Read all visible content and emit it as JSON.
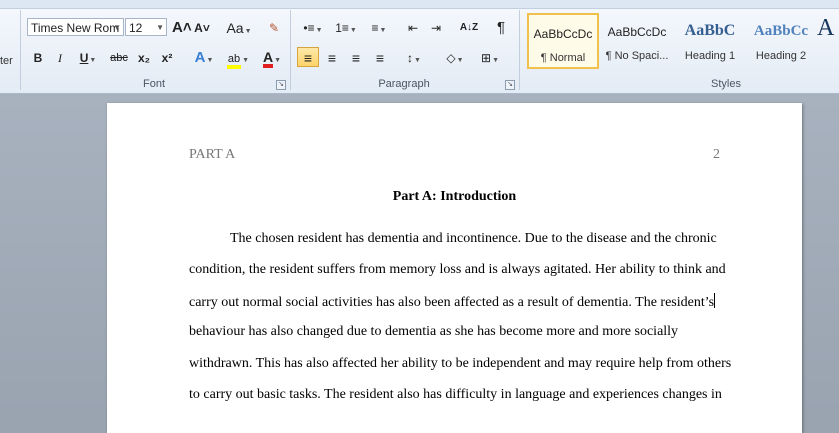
{
  "ribbon": {
    "clipboard_fragment": "ter",
    "font_group": {
      "label": "Font",
      "font_name": "Times New Rom",
      "font_size": "12",
      "grow_font": "A˄",
      "shrink_font": "A˅",
      "change_case": "Aa",
      "clear_format": "✎",
      "bold": "B",
      "italic": "I",
      "underline": "U",
      "strikethrough": "abc",
      "subscript": "x₂",
      "superscript": "x²",
      "text_effects": "A",
      "highlight": "ab",
      "font_color": "A",
      "highlight_color": "#ffff00",
      "font_color_value": "#e02020"
    },
    "paragraph_group": {
      "label": "Paragraph",
      "bullets": "•≡",
      "numbering": "1≡",
      "multilevel": "≡",
      "decrease_indent": "⇤",
      "increase_indent": "⇥",
      "sort": "A↓Z",
      "show_marks": "¶",
      "align_left": "≡",
      "center": "≡",
      "align_right": "≡",
      "justify": "≡",
      "line_spacing": "↕",
      "shading": "◇",
      "borders": "⊞",
      "accent": "#f0c24b"
    },
    "styles_group": {
      "label": "Styles",
      "items": [
        {
          "sample": "AaBbCcDc",
          "name": "¶ Normal",
          "selected": true
        },
        {
          "sample": "AaBbCcDc",
          "name": "¶ No Spaci..."
        },
        {
          "sample": "AaBbC",
          "name": "Heading 1"
        },
        {
          "sample": "AaBbCc",
          "name": "Heading 2"
        },
        {
          "sample": "A",
          "name": ""
        }
      ]
    }
  },
  "document": {
    "header_left": "PART A",
    "header_right": "2",
    "title": "Part A: Introduction",
    "lines": [
      "The chosen resident has dementia and incontinence. Due to the disease and the chronic",
      "condition, the resident suffers from memory loss and is always agitated. Her ability to think and",
      "carry out normal social activities has also been affected as a result of dementia. The resident’s",
      "behaviour has also changed due to dementia as she has become more and more socially",
      "withdrawn. This has also affected her ability to be independent and may require help from others",
      "to carry out basic tasks. The resident also has difficulty in language and experiences changes in"
    ]
  }
}
